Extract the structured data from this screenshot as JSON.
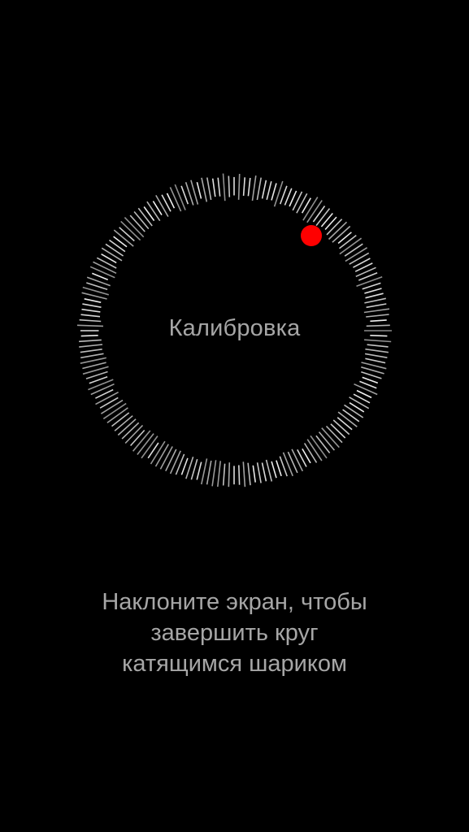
{
  "calibration": {
    "title": "Калибровка",
    "progress_fraction": 1.0,
    "ball_color": "#ff0000",
    "tick_color": "#ffffff",
    "background": "#000000"
  },
  "instructions": {
    "line1": "Наклоните экран, чтобы",
    "line2": "завершить круг",
    "line3": "катящимся шариком"
  }
}
